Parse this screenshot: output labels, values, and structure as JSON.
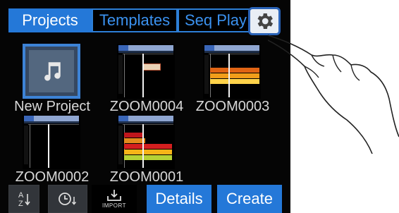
{
  "tabs": [
    {
      "label": "Projects",
      "active": true
    },
    {
      "label": "Templates",
      "active": false
    },
    {
      "label": "Seq Play",
      "active": false
    }
  ],
  "settings_icon": "gear-icon",
  "new_project": {
    "label": "New Project",
    "icon": "music-note-icon"
  },
  "projects": [
    {
      "name": "ZOOM0004"
    },
    {
      "name": "ZOOM0003"
    },
    {
      "name": "ZOOM0002"
    },
    {
      "name": "ZOOM0001"
    }
  ],
  "toolbar": {
    "sort_alpha_icon": "sort-alpha-icon",
    "sort_time_icon": "sort-time-icon",
    "import_label": "IMPORT",
    "details_label": "Details",
    "create_label": "Create"
  },
  "colors": {
    "accent": "#2478d8",
    "tab_outline": "#2d7fd7",
    "background": "#050505"
  }
}
